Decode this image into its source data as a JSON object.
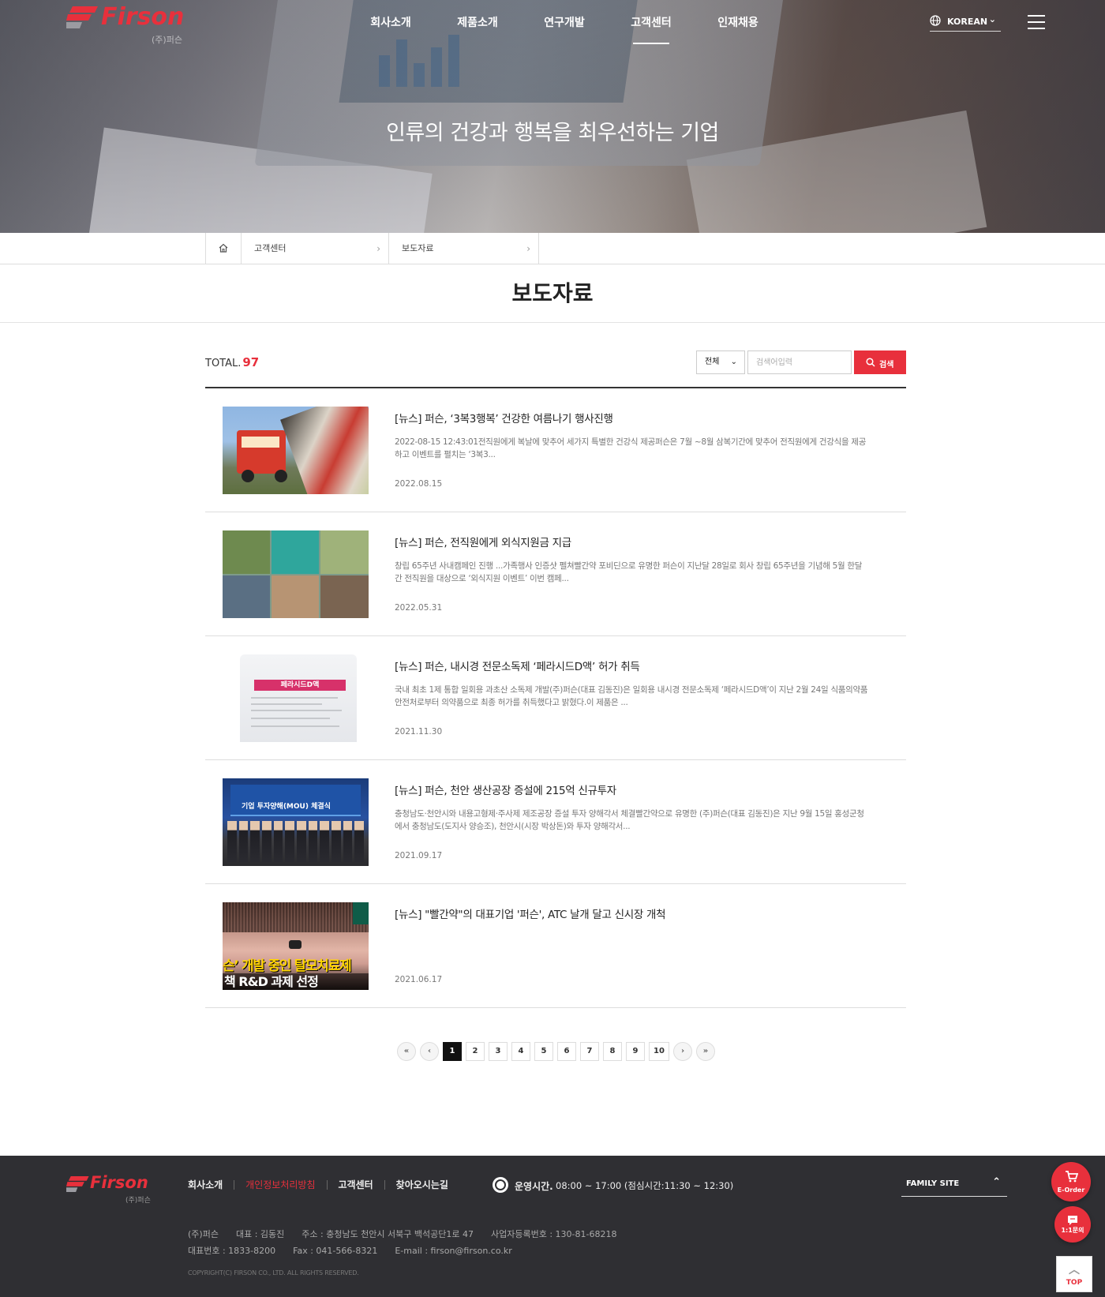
{
  "brand": {
    "name": "Firson",
    "sub": "(주)퍼슨",
    "accent": "#e8303c"
  },
  "nav": [
    {
      "label": "회사소개"
    },
    {
      "label": "제품소개"
    },
    {
      "label": "연구개발"
    },
    {
      "label": "고객센터",
      "active": true
    },
    {
      "label": "인재채용"
    }
  ],
  "language": {
    "label": "KOREAN"
  },
  "hero": {
    "title": "인류의 건강과 행복을 최우선하는 기업"
  },
  "breadcrumb": {
    "items": [
      "고객센터",
      "보도자료"
    ]
  },
  "page": {
    "title": "보도자료"
  },
  "list": {
    "total_label": "TOTAL.",
    "total": "97",
    "filter_value": "전체",
    "search_placeholder": "검색어입력",
    "search_button": "검색"
  },
  "articles": [
    {
      "title": "[뉴스] 퍼슨, ‘3복3행복’ 건강한 여름나기 행사진행",
      "summary": "2022-08-15 12:43:01전직원에게 복날에 맞추어 세가지 특별한 건강식 제공퍼슨은 7월 ~8월 삼복기간에 맞추어 전직원에게 건강식을 제공하고 이벤트를 펼치는 ‘3복3...",
      "date": "2022.08.15"
    },
    {
      "title": "[뉴스] 퍼슨, 전직원에게 외식지원금 지급",
      "summary": "창립 65주년 사내캠페인 진행 ...가족행사 인증샷 펠쳐빨간약 포비딘으로 유명한 퍼슨이 지난달 28일로 회사 창립 65주년을 기념해 5월 한달간 전직원을 대상으로 ‘외식지원 이벤트’ 이번 캠페...",
      "date": "2022.05.31"
    },
    {
      "title": "[뉴스] 퍼슨, 내시경 전문소독제 ‘페라시드D액’ 허가 취득",
      "summary": "국내 최초 1제 통합 일회용 과초산 소독제 개발(주)퍼슨(대표 김동진)은 일회용 내시경 전문소독제 ‘페라시드D액’이 지난 2월 24일 식품의약품안전처로부터 의약품으로 최종 허가를 취득했다고 밝혔다.이 제품은 ...",
      "date": "2021.11.30"
    },
    {
      "title": "[뉴스] 퍼슨, 천안 생산공장 증설에 215억 신규투자",
      "summary": "충청남도·천안시와 내용고형제·주사제 제조공장 증설 투자 양해각서 체결빨간약으로 유명한 (주)퍼슨(대표 김동진)은 지난 9월 15일 홍성군청에서 충청남도(도지사 양승조), 천안시(시장 박상돈)와 투자 양해각서...",
      "date": "2021.09.17"
    },
    {
      "title": "[뉴스] \"빨간약\"의 대표기업 '퍼슨', ATC 날개 달고 신시장 개척",
      "summary": "",
      "date": "2021.06.17"
    }
  ],
  "thumbs": {
    "bottle_label": "페라시드D액",
    "video_caption_1": "슨’ 개발 중인 탈모치료제",
    "video_caption_2": "책 R&D 과제 선정",
    "banner_text": "기업 투자양해(MOU) 체결식"
  },
  "pagination": {
    "first": "«",
    "prev": "‹",
    "next": "›",
    "last": "»",
    "pages": [
      "1",
      "2",
      "3",
      "4",
      "5",
      "6",
      "7",
      "8",
      "9",
      "10"
    ],
    "current": "1"
  },
  "footer": {
    "nav": [
      "회사소개",
      "개인정보처리방침",
      "고객센터",
      "찾아오시는길"
    ],
    "hours_label": "운영시간.",
    "hours_value": "08:00 ~ 17:00 (점심시간:11:30 ~ 12:30)",
    "family_site": "FAMILY SITE",
    "company": "(주)퍼슨",
    "ceo": "대표 : 김동진",
    "address": "주소 : 충청남도 천안시 서북구 백석공단1로 47",
    "biz_no": "사업자등록번호 : 130-81-68218",
    "tel": "대표번호 : 1833-8200",
    "fax": "Fax : 041-566-8321",
    "email": "E-mail : firson@firson.co.kr",
    "copyright": "COPYRIGHT(C) FIRSON CO., LTD. ALL RIGHTS RESERVED."
  },
  "floating": {
    "eorder": "E-Order",
    "inquiry": "1:1문의",
    "top": "TOP"
  }
}
